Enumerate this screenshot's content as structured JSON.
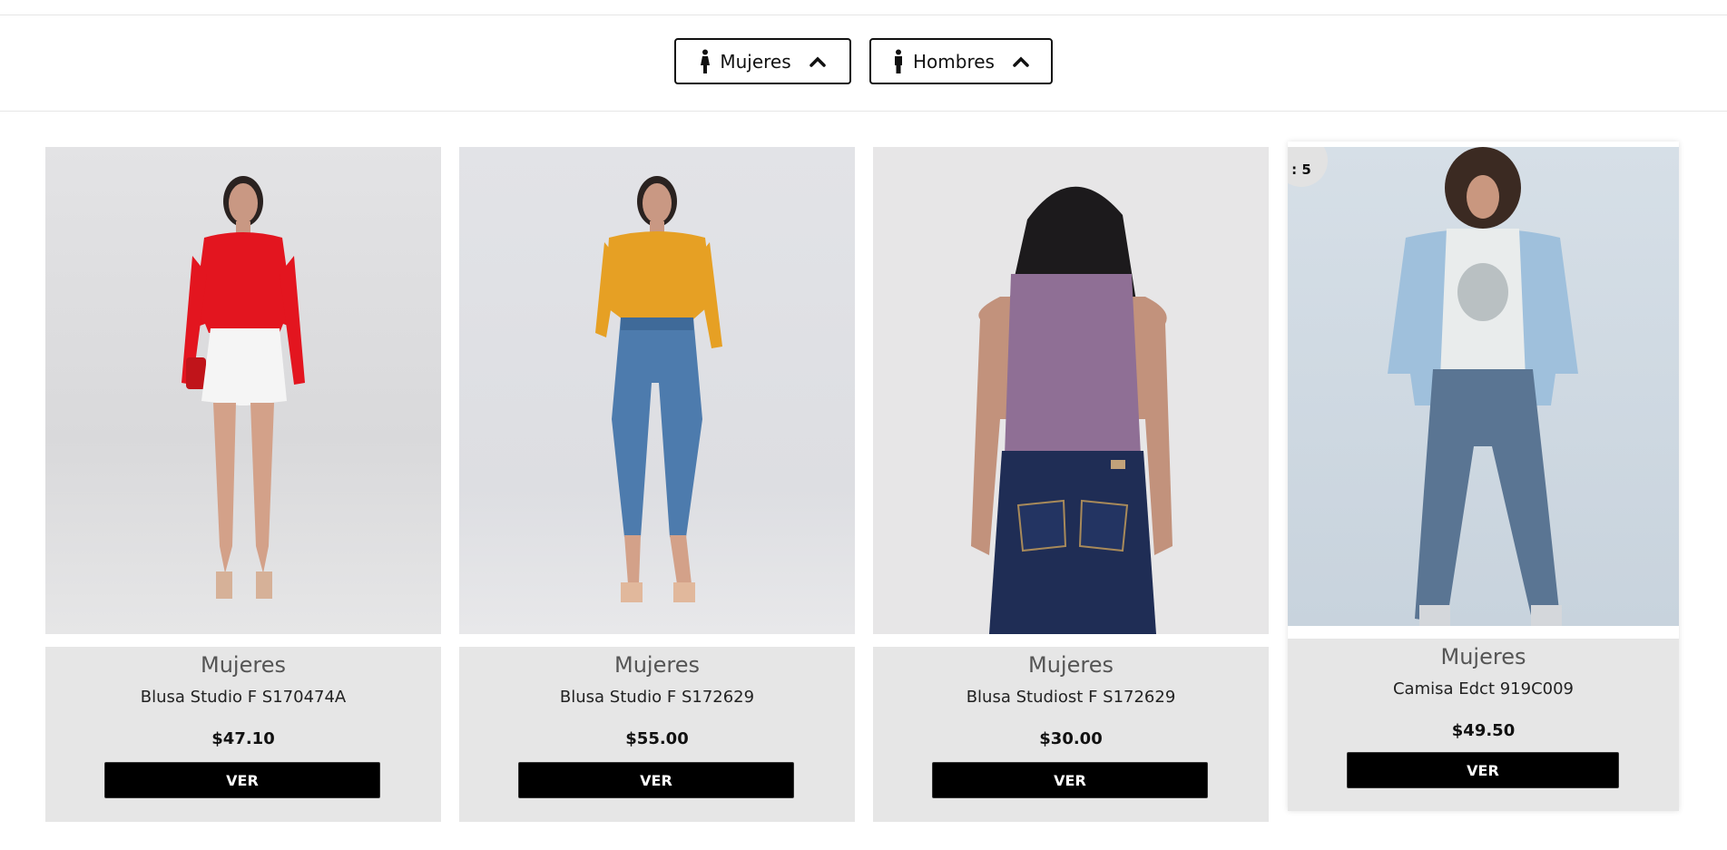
{
  "filters": [
    {
      "label": "Mujeres",
      "icon": "female-person-icon"
    },
    {
      "label": "Hombres",
      "icon": "male-person-icon"
    }
  ],
  "products": [
    {
      "category": "Mujeres",
      "name": "Blusa Studio F S170474A",
      "price": "$47.10",
      "button": "VER"
    },
    {
      "category": "Mujeres",
      "name": "Blusa Studio F S172629",
      "price": "$55.00",
      "button": "VER"
    },
    {
      "category": "Mujeres",
      "name": "Blusa Studiost F S172629",
      "price": "$30.00",
      "button": "VER"
    },
    {
      "category": "Mujeres",
      "name": "Camisa Edct 919C009",
      "price": "$49.50",
      "button": "VER",
      "badge": ": 5"
    }
  ],
  "colors": {
    "accent": "#000000",
    "card_bg": "#e6e6e6"
  }
}
